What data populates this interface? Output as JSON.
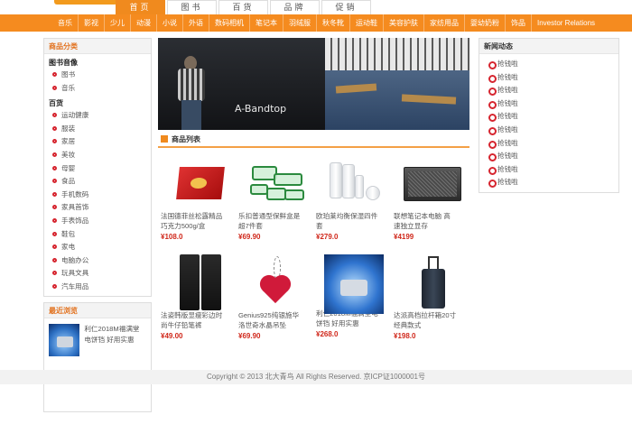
{
  "top_tabs": [
    "首页",
    "图书",
    "百货",
    "品牌",
    "促销"
  ],
  "nav": [
    "音乐",
    "影视",
    "少儿",
    "动漫",
    "小说",
    "外语",
    "数码相机",
    "笔记本",
    "羽绒服",
    "秋冬靴",
    "运动鞋",
    "美容护肤",
    "家纺用品",
    "婴幼奶粉",
    "饰品",
    "Investor Relations"
  ],
  "sidebar": {
    "category_title": "商品分类",
    "group1_title": "图书音像",
    "group1_items": [
      "图书",
      "音乐"
    ],
    "group2_title": "百货",
    "group2_items": [
      "运动健康",
      "服装",
      "家居",
      "美妆",
      "母婴",
      "食品",
      "手机数码",
      "家具首饰",
      "手表饰品",
      "鞋包",
      "家电",
      "电脑办公",
      "玩具文具",
      "汽车用品"
    ],
    "recent_title": "最近浏览",
    "recent_text": "利仁2018M福满堂电饼铛 好用实惠"
  },
  "banner": {
    "brand_text": "A-Bandtop"
  },
  "product_list_title": "商品列表",
  "products": [
    {
      "name": "法国德菲丝松露精品巧克力500g/盒",
      "price": "¥108.0"
    },
    {
      "name": "乐扣普通型保鲜盒是超7件套",
      "price": "¥69.90"
    },
    {
      "name": "欧珀莱均衡保湿四件套",
      "price": "¥279.0"
    },
    {
      "name": "联想笔记本电脑 高速独立显存",
      "price": "¥4199"
    },
    {
      "name": "法姿韩版显瘦彩边时尚牛仔铅笔裤",
      "price": "¥49.00"
    },
    {
      "name": "Genius925纯银施华洛世奇水晶吊坠",
      "price": "¥69.90"
    },
    {
      "name": "利仁2018M福满堂电饼铛 好用实惠",
      "price": "¥268.0"
    },
    {
      "name": "达派高档拉杆箱20寸 经典款式",
      "price": "¥198.0"
    }
  ],
  "news": {
    "title": "新闻动态",
    "items": [
      "抢钱啦",
      "抢钱啦",
      "抢钱啦",
      "抢钱啦",
      "抢钱啦",
      "抢钱啦",
      "抢钱啦",
      "抢钱啦",
      "抢钱啦",
      "抢钱啦"
    ]
  },
  "footer": "Copyright © 2013 北大青鸟 All Rights Reserved. 京ICP证1000001号"
}
